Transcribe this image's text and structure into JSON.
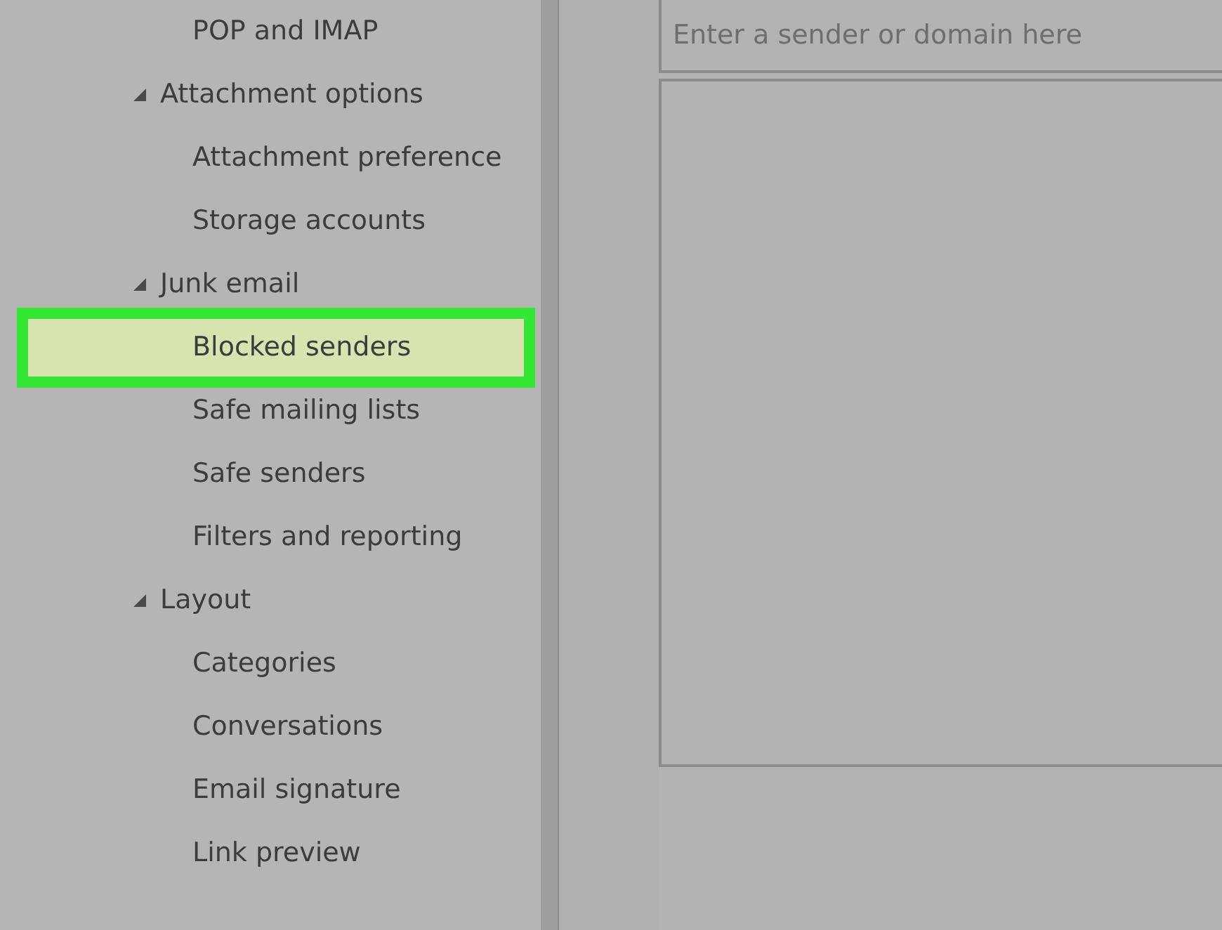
{
  "sidebar": {
    "items": [
      {
        "label": "POP and IMAP",
        "selected": false
      },
      {
        "label": "Attachment options",
        "expanded": true,
        "children": [
          {
            "label": "Attachment preference",
            "selected": false
          },
          {
            "label": "Storage accounts",
            "selected": false
          }
        ]
      },
      {
        "label": "Junk email",
        "expanded": true,
        "children": [
          {
            "label": "Blocked senders",
            "selected": true
          },
          {
            "label": "Safe mailing lists",
            "selected": false
          },
          {
            "label": "Safe senders",
            "selected": false
          },
          {
            "label": "Filters and reporting",
            "selected": false
          }
        ]
      },
      {
        "label": "Layout",
        "expanded": true,
        "children": [
          {
            "label": "Categories",
            "selected": false
          },
          {
            "label": "Conversations",
            "selected": false
          },
          {
            "label": "Email signature",
            "selected": false
          },
          {
            "label": "Link preview",
            "selected": false
          }
        ]
      }
    ]
  },
  "sender_field": {
    "placeholder": "Enter a sender or domain here"
  }
}
